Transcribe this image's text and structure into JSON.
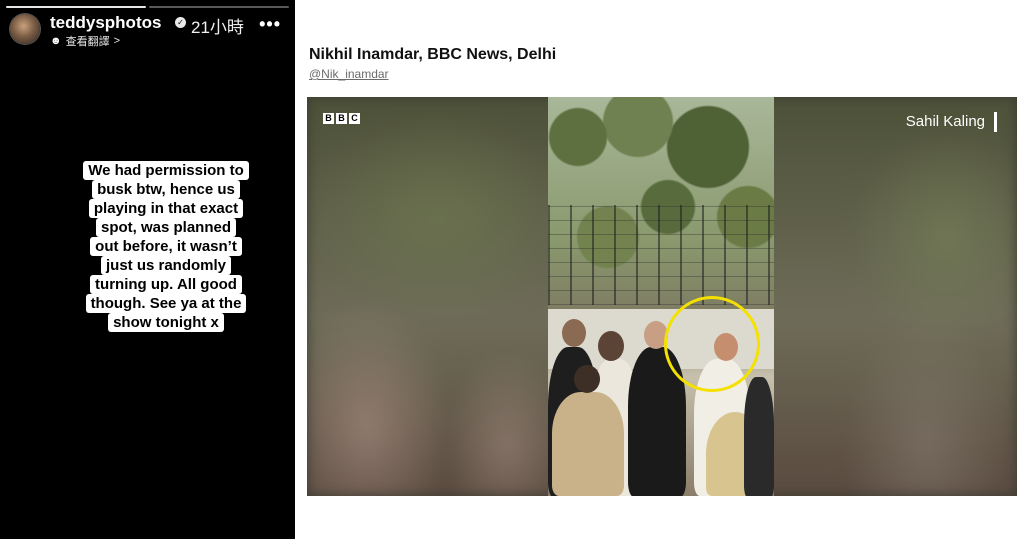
{
  "story": {
    "username": "teddysphotos",
    "time": "21小時",
    "translate_label": "查看翻譯",
    "translate_chevron": ">",
    "more_label": "•••",
    "verified_icon": "verified-badge-icon",
    "sticker_lines": [
      "We had permission to",
      "busk btw, hence us",
      "playing in that exact",
      "spot, was planned",
      "out before, it wasn’t",
      "just us randomly",
      "turning up. All good",
      "though. See ya at the",
      "show tonight x"
    ]
  },
  "embed": {
    "author_name": "Nikhil Inamdar, BBC News, Delhi",
    "author_handle": "@Nik_inamdar",
    "video": {
      "logo_letters": [
        "B",
        "B",
        "C"
      ],
      "byline": "Sahil Kaling",
      "highlight_color": "#f5e100"
    }
  }
}
